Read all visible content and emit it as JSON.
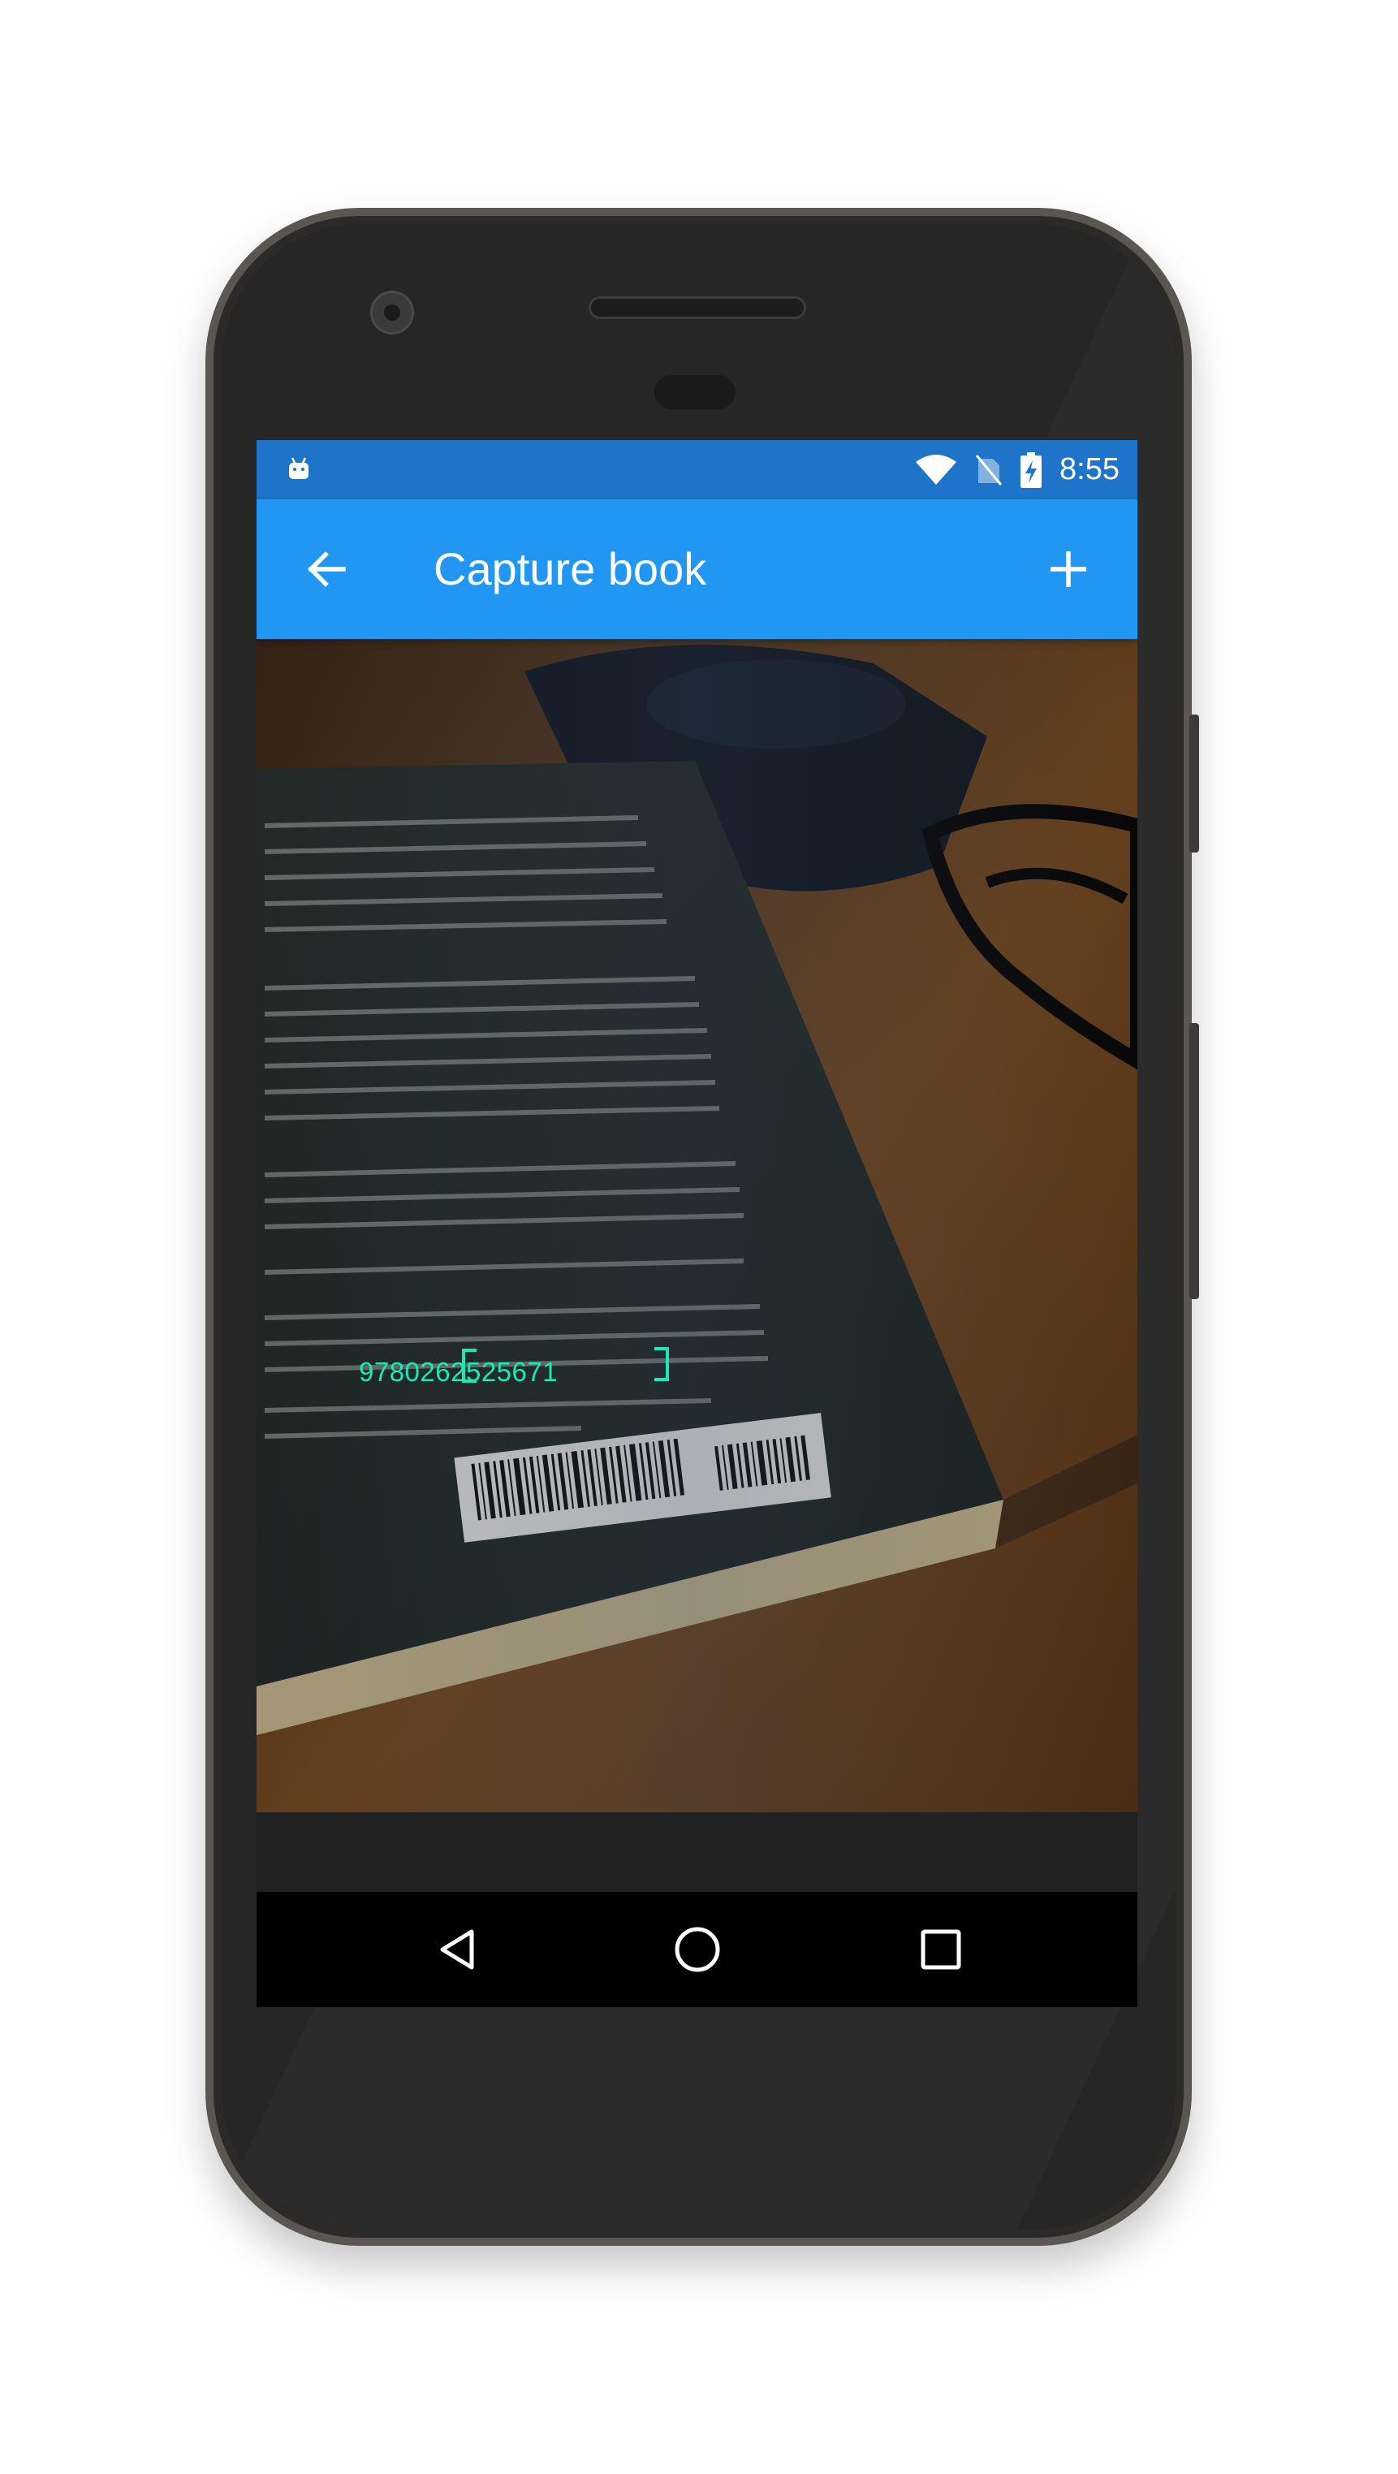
{
  "status_bar": {
    "time": "8:55",
    "icons": [
      "android-debug-icon",
      "wifi-icon",
      "no-sim-icon",
      "battery-charging-icon"
    ]
  },
  "app_bar": {
    "title": "Capture book",
    "back_icon": "arrow-left-icon",
    "action_icon": "plus-icon"
  },
  "camera_preview": {
    "subject": "book back cover with barcode",
    "detected_barcode": "9780262525671",
    "overlay_color": "#1de9b6"
  },
  "nav_bar": {
    "icons": [
      "back-triangle-icon",
      "home-circle-icon",
      "recents-square-icon"
    ]
  },
  "colors": {
    "status_bar": "#1e74c8",
    "app_bar": "#2196f3",
    "screen_bg": "#212121",
    "nav_bar": "#000000"
  }
}
